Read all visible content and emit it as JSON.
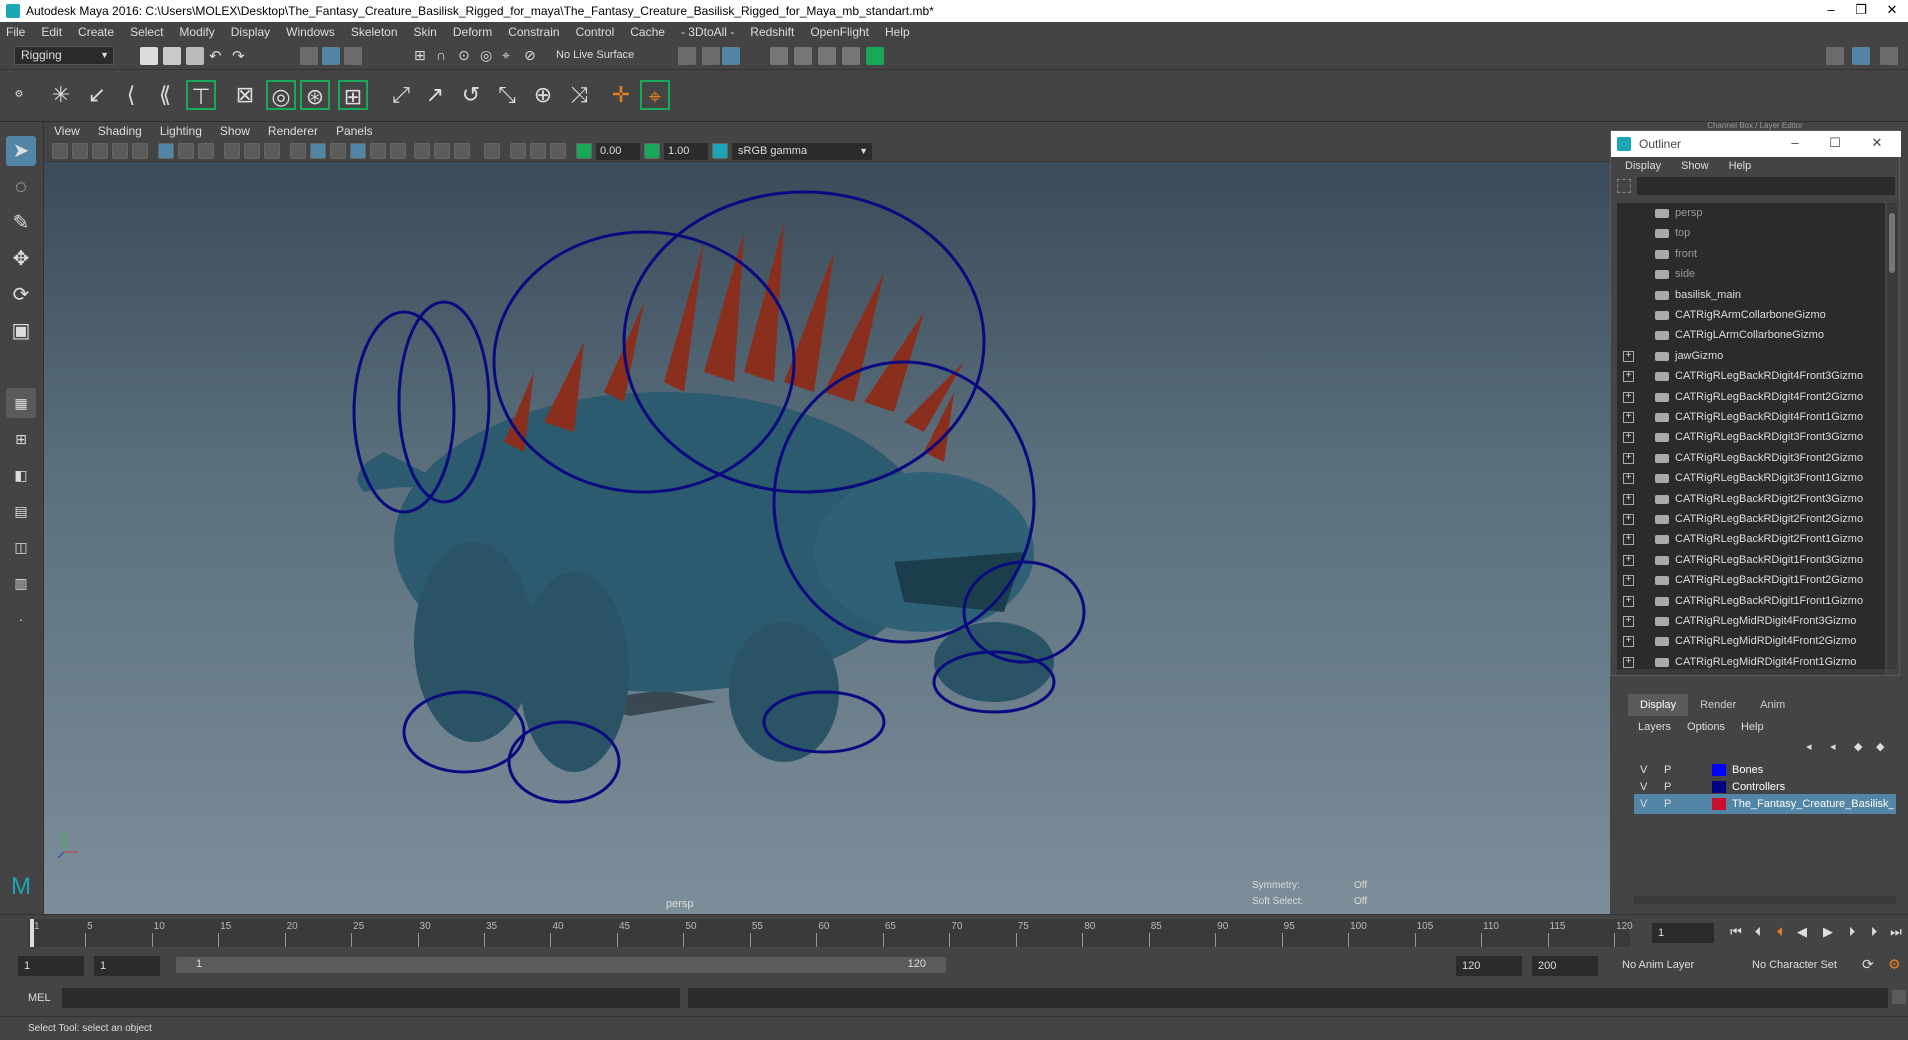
{
  "window": {
    "title": "Autodesk Maya 2016: C:\\Users\\MOLEX\\Desktop\\The_Fantasy_Creature_Basilisk_Rigged_for_maya\\The_Fantasy_Creature_Basilisk_Rigged_for_Maya_mb_standart.mb*"
  },
  "menubar": [
    "File",
    "Edit",
    "Create",
    "Select",
    "Modify",
    "Display",
    "Windows",
    "Skeleton",
    "Skin",
    "Deform",
    "Constrain",
    "Control",
    "Cache",
    "- 3DtoAll -",
    "Redshift",
    "OpenFlight",
    "Help"
  ],
  "statusline": {
    "mode": "Rigging",
    "live_surface": "No Live Surface"
  },
  "panel": {
    "menu": [
      "View",
      "Shading",
      "Lighting",
      "Show",
      "Renderer",
      "Panels"
    ],
    "near_value": "0.00",
    "far_value": "1.00",
    "color_space": "sRGB gamma",
    "camera_label": "persp",
    "symmetry_label": "Symmetry:",
    "symmetry_value": "Off",
    "soft_select_label": "Soft Select:",
    "soft_select_value": "Off"
  },
  "outliner": {
    "title": "Outliner",
    "menu": [
      "Display",
      "Show",
      "Help"
    ],
    "items": [
      {
        "name": "persp",
        "type": "camera",
        "expandable": false
      },
      {
        "name": "top",
        "type": "camera",
        "expandable": false
      },
      {
        "name": "front",
        "type": "camera",
        "expandable": false
      },
      {
        "name": "side",
        "type": "camera",
        "expandable": false
      },
      {
        "name": "basilisk_main",
        "type": "node",
        "expandable": false
      },
      {
        "name": "CATRigRArmCollarboneGizmo",
        "type": "node",
        "expandable": false
      },
      {
        "name": "CATRigLArmCollarboneGizmo",
        "type": "node",
        "expandable": false
      },
      {
        "name": "jawGizmo",
        "type": "node",
        "expandable": true
      },
      {
        "name": "CATRigRLegBackRDigit4Front3Gizmo",
        "type": "node",
        "expandable": true
      },
      {
        "name": "CATRigRLegBackRDigit4Front2Gizmo",
        "type": "node",
        "expandable": true
      },
      {
        "name": "CATRigRLegBackRDigit4Front1Gizmo",
        "type": "node",
        "expandable": true
      },
      {
        "name": "CATRigRLegBackRDigit3Front3Gizmo",
        "type": "node",
        "expandable": true
      },
      {
        "name": "CATRigRLegBackRDigit3Front2Gizmo",
        "type": "node",
        "expandable": true
      },
      {
        "name": "CATRigRLegBackRDigit3Front1Gizmo",
        "type": "node",
        "expandable": true
      },
      {
        "name": "CATRigRLegBackRDigit2Front3Gizmo",
        "type": "node",
        "expandable": true
      },
      {
        "name": "CATRigRLegBackRDigit2Front2Gizmo",
        "type": "node",
        "expandable": true
      },
      {
        "name": "CATRigRLegBackRDigit2Front1Gizmo",
        "type": "node",
        "expandable": true
      },
      {
        "name": "CATRigRLegBackRDigit1Front3Gizmo",
        "type": "node",
        "expandable": true
      },
      {
        "name": "CATRigRLegBackRDigit1Front2Gizmo",
        "type": "node",
        "expandable": true
      },
      {
        "name": "CATRigRLegBackRDigit1Front1Gizmo",
        "type": "node",
        "expandable": true
      },
      {
        "name": "CATRigRLegMidRDigit4Front3Gizmo",
        "type": "node",
        "expandable": true
      },
      {
        "name": "CATRigRLegMidRDigit4Front2Gizmo",
        "type": "node",
        "expandable": true
      },
      {
        "name": "CATRigRLegMidRDigit4Front1Gizmo",
        "type": "node",
        "expandable": true
      }
    ]
  },
  "channel_box": {
    "title": "Channel Box / Layer Editor"
  },
  "layers": {
    "tabs": [
      "Display",
      "Render",
      "Anim"
    ],
    "menu": [
      "Layers",
      "Options",
      "Help"
    ],
    "rows": [
      {
        "v": "V",
        "p": "P",
        "color": "#0000ff",
        "name": "Bones",
        "selected": false
      },
      {
        "v": "V",
        "p": "P",
        "color": "#000080",
        "name": "Controllers",
        "selected": false
      },
      {
        "v": "V",
        "p": "P",
        "color": "#c8102e",
        "name": "The_Fantasy_Creature_Basilisk_R",
        "selected": true
      }
    ]
  },
  "timeline": {
    "ticks": [
      "1",
      "5",
      "10",
      "15",
      "20",
      "25",
      "30",
      "35",
      "40",
      "45",
      "50",
      "55",
      "60",
      "65",
      "70",
      "75",
      "80",
      "85",
      "90",
      "95",
      "100",
      "105",
      "110",
      "115",
      "120"
    ],
    "current_frame": "1"
  },
  "range": {
    "start": "1",
    "anim_start": "1",
    "slider_start": "1",
    "slider_end": "120",
    "playback_end": "120",
    "anim_end": "200",
    "anim_layer": "No Anim Layer",
    "character_set": "No Character Set"
  },
  "cmdline": {
    "label": "MEL"
  },
  "helpline": {
    "text": "Select Tool: select an object"
  },
  "colors": {
    "bg": "#444444",
    "viewport_top": "#3b4b59",
    "viewport_bottom": "#7c8e99",
    "creature": "#2c5a6e",
    "spike": "#8a2e1e",
    "controller": "#0a0a80",
    "accent": "#1aa6b7"
  }
}
